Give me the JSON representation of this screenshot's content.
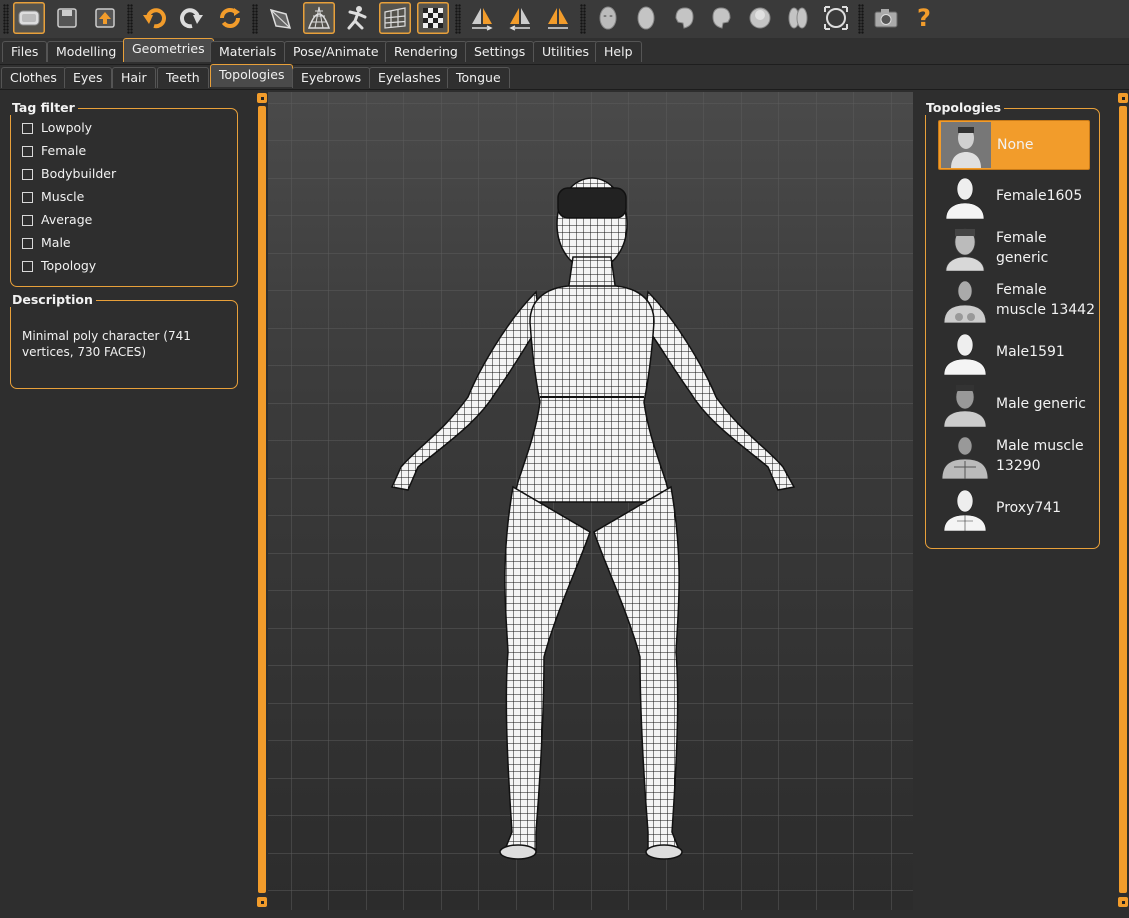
{
  "toolbar": {
    "icons": [
      "save-scene-icon",
      "save-icon",
      "export-icon",
      "undo-icon",
      "redo-icon",
      "reset-icon",
      "smooth-icon",
      "wireframe-icon",
      "pose-icon",
      "grid-icon",
      "checker-background-icon",
      "symmetry-right-icon",
      "symmetry-left-icon",
      "symmetry-icon",
      "front-view-icon",
      "back-view-icon",
      "left-view-icon",
      "right-view-icon",
      "top-view-icon",
      "bottom-view-icon",
      "reset-camera-icon",
      "screenshot-icon",
      "help-icon"
    ],
    "help_glyph": "?",
    "accent_color": "#e8a03a"
  },
  "menu": {
    "tabs": [
      "Files",
      "Modelling",
      "Geometries",
      "Materials",
      "Pose/Animate",
      "Rendering",
      "Settings",
      "Utilities",
      "Help"
    ],
    "active": "Geometries"
  },
  "subtabs": {
    "tabs": [
      "Clothes",
      "Eyes",
      "Hair",
      "Teeth",
      "Topologies",
      "Eyebrows",
      "Eyelashes",
      "Tongue"
    ],
    "active": "Topologies"
  },
  "tag_filter": {
    "title": "Tag filter",
    "items": [
      "Lowpoly",
      "Female",
      "Bodybuilder",
      "Muscle",
      "Average",
      "Male",
      "Topology"
    ]
  },
  "description": {
    "title": "Description",
    "text": "Minimal poly character (741 vertices, 730 FACES)"
  },
  "topologies": {
    "title": "Topologies",
    "selected": "None",
    "items": [
      {
        "label": "None",
        "thumb": "male-bust-icon"
      },
      {
        "label": "Female1605",
        "thumb": "female-bust-icon"
      },
      {
        "label": "Female generic",
        "thumb": "female-bust-icon"
      },
      {
        "label": "Female muscle 13442",
        "thumb": "female-muscle-bust-icon"
      },
      {
        "label": "Male1591",
        "thumb": "male-bust-icon"
      },
      {
        "label": "Male generic",
        "thumb": "male-bust-icon"
      },
      {
        "label": "Male muscle 13290",
        "thumb": "male-muscle-bust-icon"
      },
      {
        "label": "Proxy741",
        "thumb": "proxy-bust-icon"
      }
    ]
  }
}
